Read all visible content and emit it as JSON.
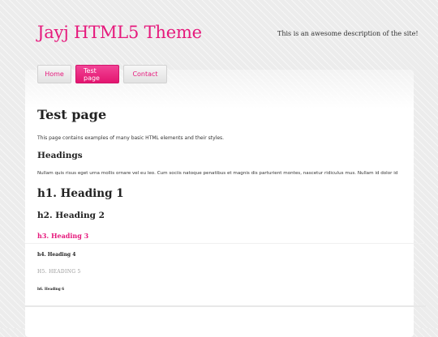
{
  "site": {
    "title": "Jayj HTML5 Theme",
    "description": "This is an awesome description of the site!"
  },
  "nav": {
    "items": [
      {
        "label": "Home",
        "active": false
      },
      {
        "label": "Test page",
        "active": true
      },
      {
        "label": "Contact",
        "active": false
      }
    ]
  },
  "page": {
    "title": "Test page",
    "intro": "This page contains examples of many basic HTML elements and their styles.",
    "section_heading": "Headings",
    "lorem": "Nullam quis risus eget urna mollis ornare vel eu leo. Cum sociis natoque penatibus et magnis dis parturient montes, nascetur ridiculus mus. Nullam id dolor id",
    "h1": "h1. Heading 1",
    "h2": "h2. Heading 2",
    "h3": "h3. Heading 3",
    "h4": "h4. Heading 4",
    "h5": "h5. Heading 5",
    "h6": "h6. Heading 6"
  },
  "colors": {
    "accent": "#e6197c",
    "background": "#ececec",
    "content_bg": "#ffffff"
  }
}
